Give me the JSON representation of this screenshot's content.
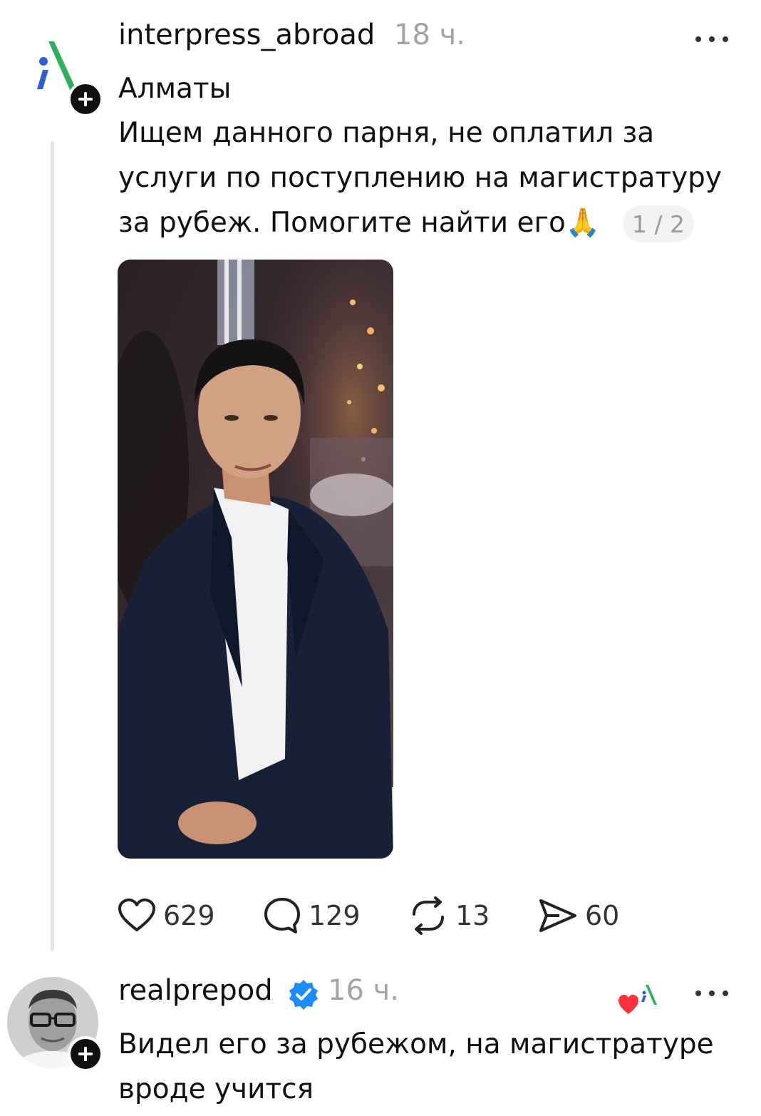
{
  "post": {
    "username": "interpress_abroad",
    "time": "18 ч.",
    "location": "Алматы",
    "text_lines": [
      "Ищем данного парня, не оплатил за",
      "услуги по поступлению на магистратуру",
      "за рубеж. Помогите найти его"
    ],
    "emoji": "🙏",
    "media_counter": "1 / 2",
    "likes": "629",
    "comments": "129",
    "reposts": "13",
    "shares": "60"
  },
  "reply": {
    "username": "realprepod",
    "time": "16 ч.",
    "text_lines": [
      "Видел его за рубежом, на магистратуре",
      "вроде учится"
    ]
  },
  "colors": {
    "logo_blue": "#2f5fd0",
    "logo_green": "#2fae5e",
    "verified": "#1d8cf8",
    "like_heart": "#ff3040"
  },
  "icons": {
    "more": "more-dots-icon",
    "like": "heart-icon",
    "comment": "comment-bubble-icon",
    "repost": "repost-icon",
    "share": "send-icon"
  }
}
